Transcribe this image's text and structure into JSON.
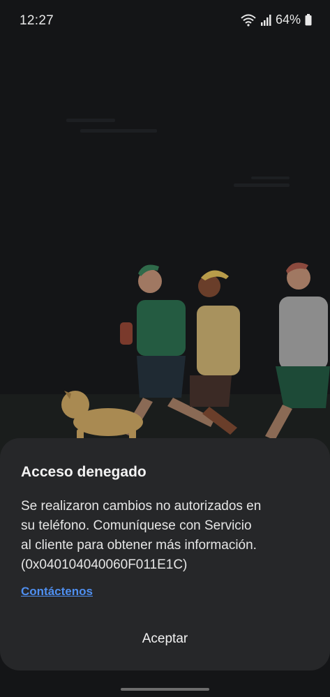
{
  "status_bar": {
    "time": "12:27",
    "battery": "64%",
    "icons": [
      "wifi-icon",
      "signal-icon",
      "battery-icon"
    ]
  },
  "illustration": {
    "icon": "running-people-dog-illustration"
  },
  "dialog": {
    "title": "Acceso denegado",
    "body": "Se realizaron cambios no autorizados en\nsu teléfono. Comuníquese con Servicio\nal cliente para obtener más información.\n(0x040104040060F011E1C)",
    "link": "Contáctenos",
    "button": "Aceptar"
  },
  "colors": {
    "background": "#141517",
    "dialog": "#262729",
    "link": "#4f8ff0"
  }
}
